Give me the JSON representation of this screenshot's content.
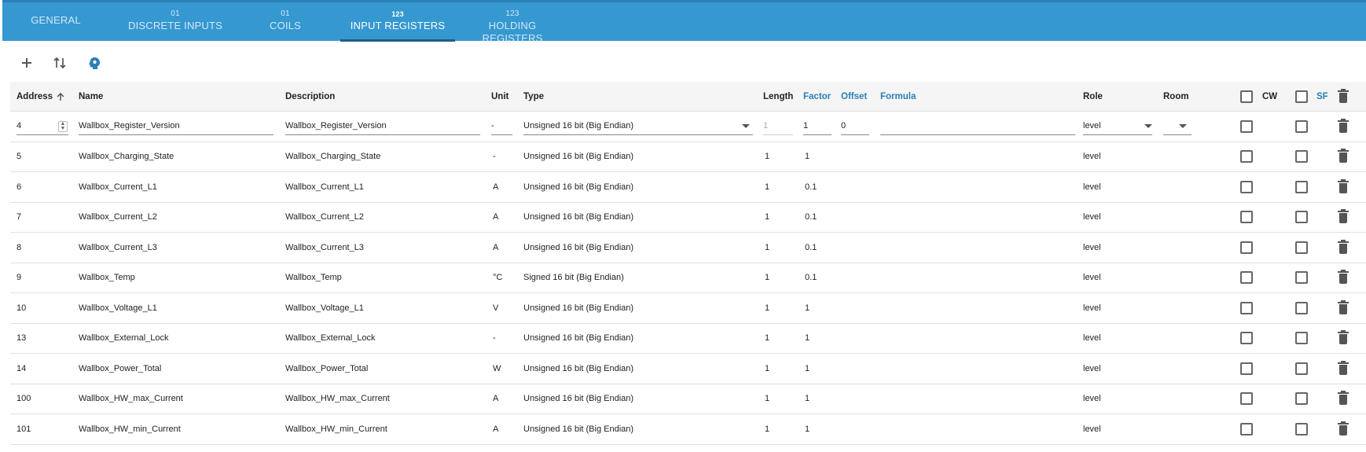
{
  "tabs": [
    {
      "icon": "",
      "label": "GENERAL"
    },
    {
      "icon": "01",
      "label": "DISCRETE INPUTS"
    },
    {
      "icon": "01",
      "label": "COILS"
    },
    {
      "icon": "123",
      "label": "INPUT REGISTERS"
    },
    {
      "icon": "123",
      "label": "HOLDING REGISTERS"
    }
  ],
  "active_tab": "INPUT REGISTERS",
  "toolbar": {
    "add_icon": "plus-icon",
    "sort_icon": "swap-vertical-icon",
    "import_icon": "head-icon"
  },
  "columns": {
    "address": "Address",
    "name": "Name",
    "description": "Description",
    "unit": "Unit",
    "type": "Type",
    "length": "Length",
    "factor": "Factor",
    "offset": "Offset",
    "formula": "Formula",
    "role": "Role",
    "room": "Room",
    "cw": "CW",
    "sf": "SF"
  },
  "colors": {
    "tabbar": "#3598d1",
    "accent": "#2a7fb4"
  },
  "edit_row": {
    "address": "4",
    "name": "Wallbox_Register_Version",
    "description": "Wallbox_Register_Version",
    "unit": "-",
    "type": "Unsigned 16 bit (Big Endian)",
    "length": "1",
    "factor": "1",
    "offset": "0",
    "formula": "",
    "role": "level",
    "room": ""
  },
  "rows": [
    {
      "address": "5",
      "name": "Wallbox_Charging_State",
      "description": "Wallbox_Charging_State",
      "unit": "-",
      "type": "Unsigned 16 bit (Big Endian)",
      "length": "1",
      "factor": "1",
      "role": "level"
    },
    {
      "address": "6",
      "name": "Wallbox_Current_L1",
      "description": "Wallbox_Current_L1",
      "unit": "A",
      "type": "Unsigned 16 bit (Big Endian)",
      "length": "1",
      "factor": "0.1",
      "role": "level"
    },
    {
      "address": "7",
      "name": "Wallbox_Current_L2",
      "description": "Wallbox_Current_L2",
      "unit": "A",
      "type": "Unsigned 16 bit (Big Endian)",
      "length": "1",
      "factor": "0.1",
      "role": "level"
    },
    {
      "address": "8",
      "name": "Wallbox_Current_L3",
      "description": "Wallbox_Current_L3",
      "unit": "A",
      "type": "Unsigned 16 bit (Big Endian)",
      "length": "1",
      "factor": "0.1",
      "role": "level"
    },
    {
      "address": "9",
      "name": "Wallbox_Temp",
      "description": "Wallbox_Temp",
      "unit": "°C",
      "type": "Signed 16 bit (Big Endian)",
      "length": "1",
      "factor": "0.1",
      "role": "level"
    },
    {
      "address": "10",
      "name": "Wallbox_Voltage_L1",
      "description": "Wallbox_Voltage_L1",
      "unit": "V",
      "type": "Unsigned 16 bit (Big Endian)",
      "length": "1",
      "factor": "1",
      "role": "level"
    },
    {
      "address": "13",
      "name": "Wallbox_External_Lock",
      "description": "Wallbox_External_Lock",
      "unit": "-",
      "type": "Unsigned 16 bit (Big Endian)",
      "length": "1",
      "factor": "1",
      "role": "level"
    },
    {
      "address": "14",
      "name": "Wallbox_Power_Total",
      "description": "Wallbox_Power_Total",
      "unit": "W",
      "type": "Unsigned 16 bit (Big Endian)",
      "length": "1",
      "factor": "1",
      "role": "level"
    },
    {
      "address": "100",
      "name": "Wallbox_HW_max_Current",
      "description": "Wallbox_HW_max_Current",
      "unit": "A",
      "type": "Unsigned 16 bit (Big Endian)",
      "length": "1",
      "factor": "1",
      "role": "level"
    },
    {
      "address": "101",
      "name": "Wallbox_HW_min_Current",
      "description": "Wallbox_HW_min_Current",
      "unit": "A",
      "type": "Unsigned 16 bit (Big Endian)",
      "length": "1",
      "factor": "1",
      "role": "level"
    }
  ]
}
